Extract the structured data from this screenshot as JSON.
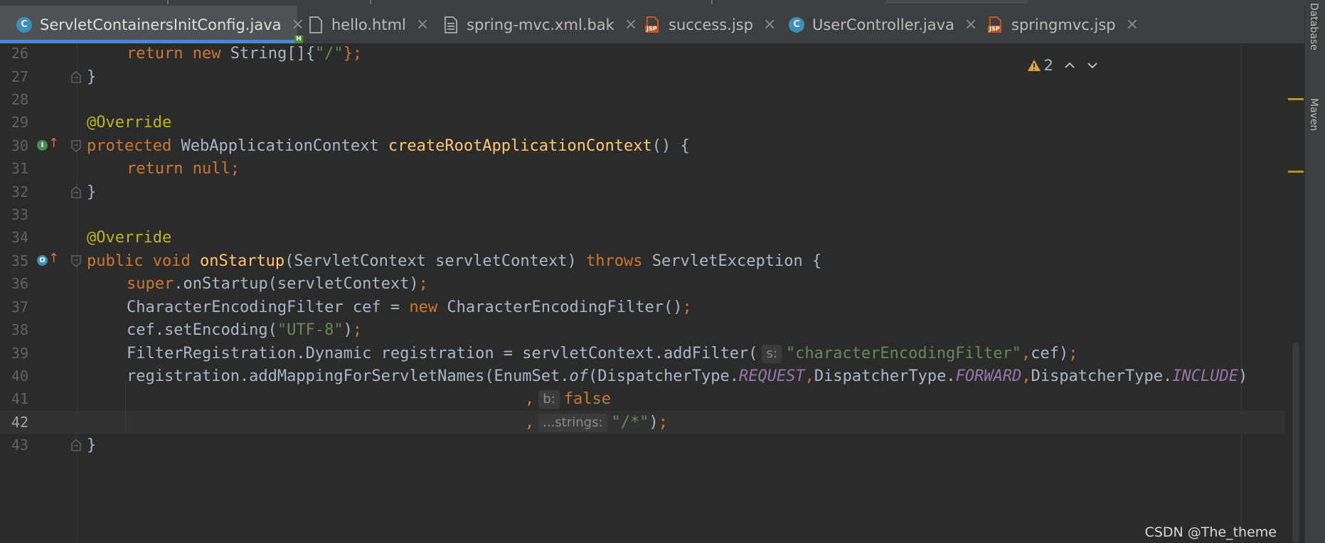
{
  "tabs": [
    {
      "label": "ServletContainersInitConfig.java",
      "icon": "java-class-icon",
      "active": true
    },
    {
      "label": "hello.html",
      "icon": "html-file-icon"
    },
    {
      "label": "spring-mvc.xml.bak",
      "icon": "text-file-icon"
    },
    {
      "label": "success.jsp",
      "icon": "jsp-file-icon"
    },
    {
      "label": "UserController.java",
      "icon": "java-class-icon"
    },
    {
      "label": "springmvc.jsp",
      "icon": "jsp-file-icon"
    }
  ],
  "close_glyph": "×",
  "inspection": {
    "warnings": "2"
  },
  "right_panels": [
    "Database",
    "Maven"
  ],
  "lines": [
    {
      "n": "26"
    },
    {
      "n": "27"
    },
    {
      "n": "28"
    },
    {
      "n": "29"
    },
    {
      "n": "30"
    },
    {
      "n": "31"
    },
    {
      "n": "32"
    },
    {
      "n": "33"
    },
    {
      "n": "34"
    },
    {
      "n": "35"
    },
    {
      "n": "36"
    },
    {
      "n": "37"
    },
    {
      "n": "38"
    },
    {
      "n": "39"
    },
    {
      "n": "40"
    },
    {
      "n": "41"
    },
    {
      "n": "42"
    },
    {
      "n": "43"
    }
  ],
  "code": {
    "l26": {
      "kw_return": "return",
      "kw_new": "new",
      "type": " String[]{",
      "str": "\"/\"",
      "end": "};"
    },
    "l27": {
      "brace": "}"
    },
    "l29": {
      "ann": "@Override"
    },
    "l30": {
      "kw": "protected",
      "type": " WebApplicationContext ",
      "fn": "createRootApplicationContext",
      "rest": "() {"
    },
    "l31": {
      "kw_return": "return",
      "kw_null": " null;"
    },
    "l32": {
      "brace": "}"
    },
    "l34": {
      "ann": "@Override"
    },
    "l35": {
      "kw_public": "public",
      "kw_void": " void ",
      "fn": "onStartup",
      "params": "(ServletContext servletContext) ",
      "kw_throws": "throws",
      "rest": " ServletException {"
    },
    "l36": {
      "kw_super": "super",
      "call": ".onStartup(servletContext)",
      "semi": ";"
    },
    "l37": {
      "type": "CharacterEncodingFilter cef = ",
      "kw_new": "new",
      "rest": " CharacterEncodingFilter()",
      "semi": ";"
    },
    "l38": {
      "call": "cef.setEncoding(",
      "str": "\"UTF-8\"",
      "rest": ")",
      "semi": ";"
    },
    "l39": {
      "pre": "FilterRegistration.Dynamic registration = servletContext.addFilter(",
      "hint": "s:",
      "str": "\"characterEncodingFilter\"",
      "comma": ",",
      "rest": "cef)",
      "semi": ";"
    },
    "l40": {
      "pre": "registration.addMappingForServletNames(EnumSet.",
      "of": "of",
      "p1": "(DispatcherType.",
      "c1": "REQUEST",
      "comma1": ",",
      "p2": "DispatcherType.",
      "c2": "FORWARD",
      "comma2": ",",
      "p3": "DispatcherType.",
      "c3": "INCLUDE",
      "end": ")"
    },
    "l41": {
      "comma": ",",
      "hint": "b:",
      "kw_false": "false"
    },
    "l42": {
      "comma": ",",
      "hint": "...strings:",
      "str": "\"/*\"",
      "rest": ")",
      "semi": ";"
    },
    "l43": {
      "brace": "}"
    }
  },
  "watermark": "CSDN @The_theme",
  "colors": {
    "keyword": "#cc7832",
    "string": "#6a8759",
    "annotation": "#bbb529",
    "function": "#ffc66d",
    "constant": "#9876aa",
    "text": "#a9b7c6",
    "background": "#2b2b2b",
    "tab_underline": "#4a88c7"
  }
}
